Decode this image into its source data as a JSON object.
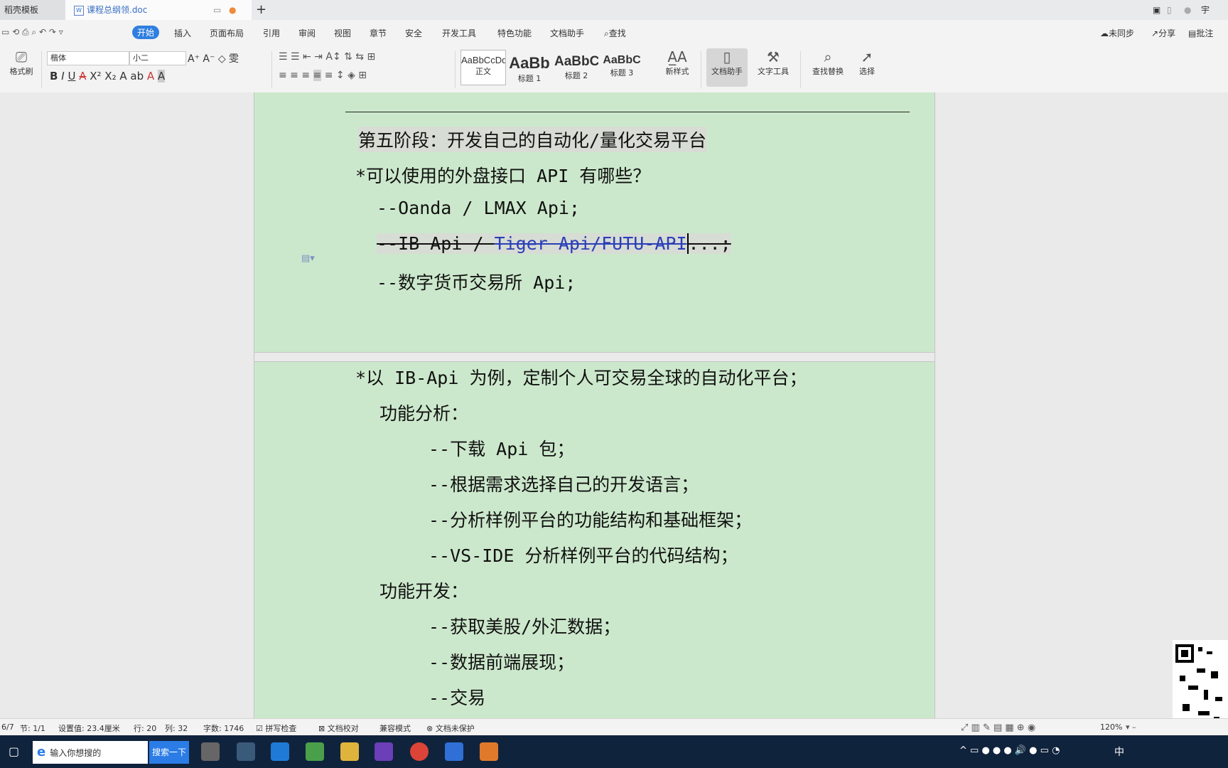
{
  "tabs": [
    {
      "label": "稻壳模板"
    },
    {
      "label": "课程总纲领.doc"
    }
  ],
  "menu": {
    "items": [
      "开始",
      "插入",
      "页面布局",
      "引用",
      "审阅",
      "视图",
      "章节",
      "安全",
      "开发工具",
      "特色功能",
      "文档助手",
      "查找"
    ],
    "right": [
      "未同步",
      "分享",
      "批注"
    ]
  },
  "ribbon": {
    "format_painter": "格式刷",
    "font_name": "楷体",
    "font_size": "小二",
    "styles": [
      {
        "preview": "AaBbCcDd",
        "label": "正文"
      },
      {
        "preview": "AaBb",
        "label": "标题 1"
      },
      {
        "preview": "AaBbC",
        "label": "标题 2"
      },
      {
        "preview": "AaBbC",
        "label": "标题 3"
      }
    ],
    "new_style": "新样式",
    "doc_assistant": "文档助手",
    "text_tools": "文字工具",
    "find_replace": "查找替换",
    "select": "选择"
  },
  "document": {
    "lines": [
      "第五阶段：开发自己的自动化/量化交易平台",
      "*可以使用的外盘接口 API 有哪些？",
      "--Oanda / LMAX Api;",
      "--IB Api / ",
      "Tiger Api/FUTU-API",
      "...;",
      "--数字货币交易所 Api;",
      "*以 IB-Api 为例，定制个人可交易全球的自动化平台；",
      "功能分析：",
      "--下载 Api 包；",
      "--根据需求选择自己的开发语言；",
      "--分析样例平台的功能结构和基础框架；",
      "--VS-IDE 分析样例平台的代码结构；",
      "功能开发：",
      "--获取美股/外汇数据；",
      "--数据前端展现；",
      "--交易"
    ]
  },
  "status": {
    "page": "6/7",
    "section": "节: 1/1",
    "setting": "设置值: 23.4厘米",
    "row": "行: 20",
    "col": "列: 32",
    "words": "字数: 1746",
    "spell": "拼写检查",
    "proof": "文档校对",
    "compat": "兼容模式",
    "protect": "文档未保护",
    "zoom": "120%"
  },
  "taskbar": {
    "search_placeholder": "输入你想搜的",
    "search_button": "搜索一下",
    "ime": "中"
  },
  "colors": {
    "accent": "#2f7fe0",
    "page_bg": "#cce8cc",
    "taskbar": "#10233d"
  }
}
